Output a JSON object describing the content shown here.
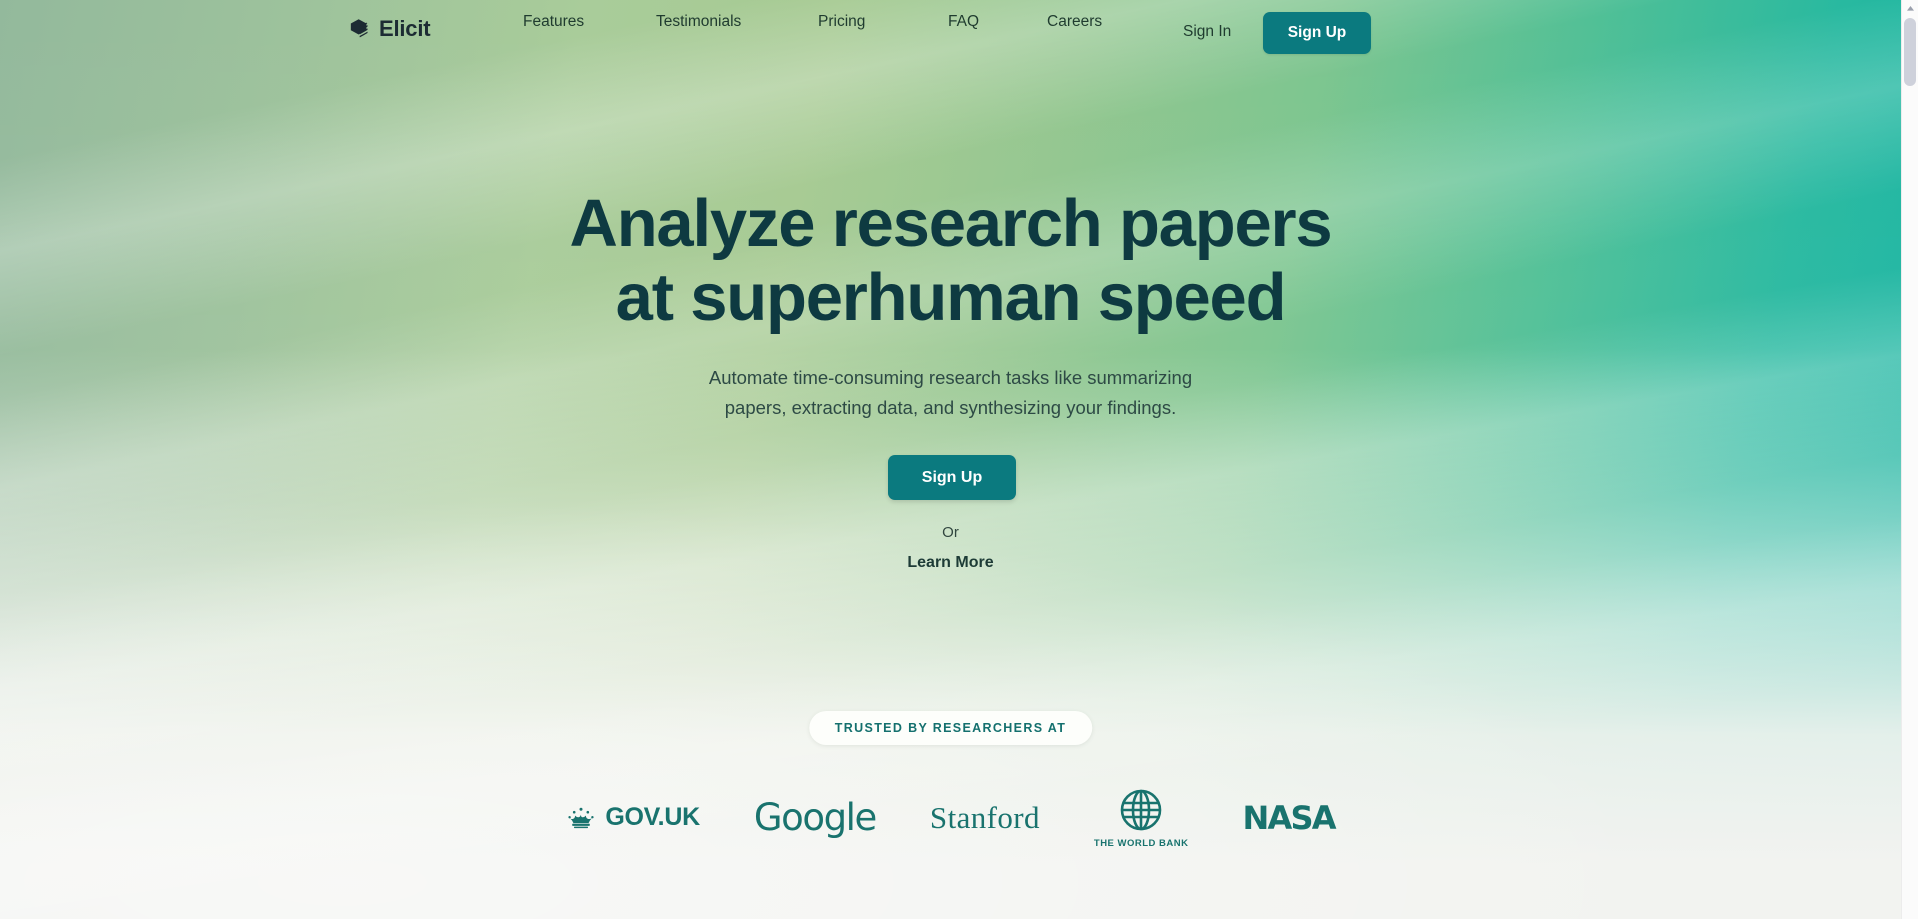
{
  "brand": {
    "name": "Elicit",
    "icon": "stacked-books-logo-icon"
  },
  "header": {
    "nav_links": [
      {
        "label": "Features"
      },
      {
        "label": "Testimonials"
      },
      {
        "label": "Pricing"
      },
      {
        "label": "FAQ"
      },
      {
        "label": "Careers"
      }
    ],
    "sign_in_label": "Sign In",
    "sign_up_label": "Sign Up"
  },
  "hero": {
    "title_line1": "Analyze research papers",
    "title_line2": "at superhuman speed",
    "subtitle_line1": "Automate time-consuming research tasks like summarizing",
    "subtitle_line2": "papers, extracting data, and synthesizing your findings.",
    "cta_label": "Sign Up",
    "or_label": "Or",
    "secondary_cta_label": "Learn More"
  },
  "trusted": {
    "badge_label": "TRUSTED BY RESEARCHERS AT",
    "logos": [
      {
        "name": "GOV.UK",
        "icon": "crown-icon"
      },
      {
        "name": "Google",
        "icon": "google-wordmark-icon"
      },
      {
        "name": "Stanford",
        "icon": "stanford-wordmark-icon"
      },
      {
        "name": "THE WORLD BANK",
        "icon": "globe-icon"
      },
      {
        "name": "NASA",
        "icon": "nasa-worm-icon"
      }
    ]
  },
  "colors": {
    "accent_teal": "#0b7a7f",
    "heading_dark_teal": "#0e3a41",
    "logo_teal": "#19736e",
    "badge_teal": "#14706e",
    "bg_left_green": "#93b99c",
    "bg_right_teal": "#14b3a3",
    "bg_bottom": "#f2f3f0"
  },
  "scrollbar": {
    "up_arrow_icon": "chevron-up-icon"
  }
}
